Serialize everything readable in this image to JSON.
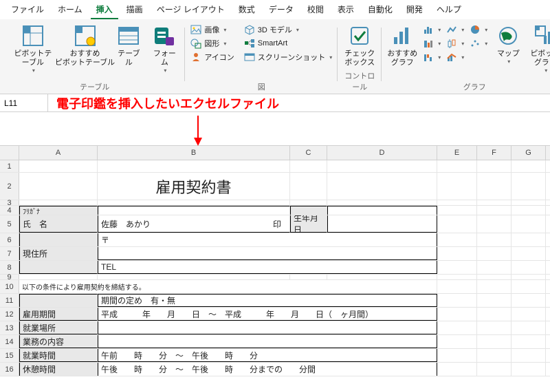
{
  "tabs": [
    "ファイル",
    "ホーム",
    "挿入",
    "描画",
    "ページ レイアウト",
    "数式",
    "データ",
    "校閲",
    "表示",
    "自動化",
    "開発",
    "ヘルプ"
  ],
  "active_tab_index": 2,
  "ribbon": {
    "groups": {
      "tables": {
        "label": "テーブル",
        "pivot": "ピボットテーブル",
        "rec_pivot": "おすすめ\nピボットテーブル",
        "table": "テーブル",
        "form": "フォーム"
      },
      "illustrations": {
        "label": "図",
        "image": "画像",
        "shape": "図形",
        "icon": "アイコン",
        "model3d": "3D モデル",
        "smartart": "SmartArt",
        "screenshot": "スクリーンショット"
      },
      "controls": {
        "label": "コントロール",
        "checkbox": "チェック\nボックス"
      },
      "charts": {
        "label": "グラフ",
        "recommended": "おすすめ\nグラフ",
        "map": "マップ",
        "pivotchart": "ピボットグラフ"
      }
    }
  },
  "namebox": "L11",
  "annotation": "電子印鑑を挿入したいエクセルファイル",
  "columns": [
    "A",
    "B",
    "C",
    "D",
    "E",
    "F",
    "G"
  ],
  "rows": [
    1,
    2,
    3,
    4,
    5,
    6,
    7,
    8,
    9,
    10,
    11,
    12,
    13,
    14,
    15,
    16
  ],
  "form": {
    "title": "雇用契約書",
    "name_ruby": "ﾌﾘｶﾞﾅ",
    "name_label": "氏　名",
    "name_value": "佐藤　あかり",
    "seal": "印",
    "dob": "生年月日",
    "addr_label": "現住所",
    "addr_mark": "〒",
    "tel": "TEL",
    "clause": "以下の条件により雇用契約を締結する。",
    "period_label": "雇用期間",
    "period_top": "期間の定め　有・無",
    "period_line": "平成　　　年　　月　　日　～　平成　　　年　　月　　日（　ヶ月間）",
    "workplace": "就業場所",
    "jobcontent": "業務の内容",
    "worktime_label": "就業時間",
    "worktime_line": "午前　　時　　分　～　午後　　時　　分",
    "resttime_label": "休憩時間",
    "resttime_line": "午後　　時　　分　～　午後　　時　　分までの　　分間"
  }
}
